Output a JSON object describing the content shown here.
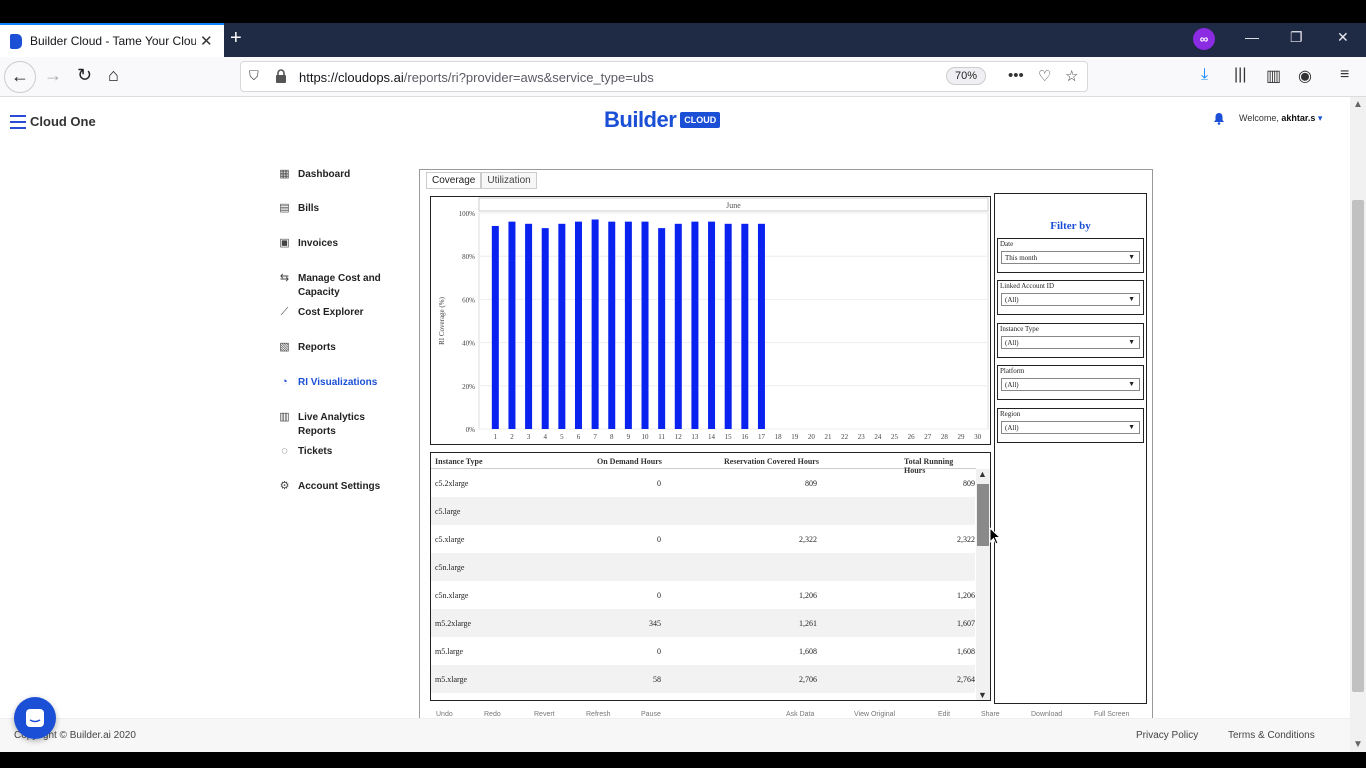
{
  "browser": {
    "tab_title": "Builder Cloud - Tame Your Clou",
    "url_host": "https://cloudops.ai",
    "url_path": "/reports/ri?provider=aws&service_type=ubs",
    "zoom": "70%"
  },
  "header": {
    "brand": "Cloud One",
    "logo_word": "Builder",
    "logo_badge": "CLOUD",
    "welcome_prefix": "Welcome,",
    "username": "akhtar.s",
    "username_caret": "▾"
  },
  "sidebar": {
    "items": [
      {
        "label": "Dashboard",
        "icon": "grid-icon"
      },
      {
        "label": "Bills",
        "icon": "list-icon"
      },
      {
        "label": "Invoices",
        "icon": "invoice-icon"
      },
      {
        "label": "Manage Cost and Capacity",
        "icon": "arrows-icon"
      },
      {
        "label": "Cost Explorer",
        "icon": "trend-icon"
      },
      {
        "label": "Reports",
        "icon": "report-icon"
      },
      {
        "label": "RI Visualizations",
        "icon": "pie-icon",
        "active": true
      },
      {
        "label": "Live Analytics Reports",
        "icon": "bar-chart-icon"
      },
      {
        "label": "Tickets",
        "icon": "chat-bubble-icon"
      },
      {
        "label": "Account Settings",
        "icon": "gear-icon"
      }
    ]
  },
  "report": {
    "tabs": [
      "Coverage",
      "Utilization"
    ],
    "active_tab": "Coverage",
    "filter_title": "Filter by",
    "filters": [
      {
        "label": "Date",
        "value": "This month"
      },
      {
        "label": "Linked Account ID",
        "value": "(All)"
      },
      {
        "label": "Instance Type",
        "value": "(All)"
      },
      {
        "label": "Platform",
        "value": "(All)"
      },
      {
        "label": "Region",
        "value": "(All)"
      }
    ],
    "table": {
      "columns": [
        "Instance Type",
        "On Demand Hours",
        "Reservation Covered Hours",
        "Total Running Hours"
      ],
      "rows": [
        [
          "c5.2xlarge",
          "0",
          "809",
          "809"
        ],
        [
          "c5.large",
          "",
          "",
          ""
        ],
        [
          "c5.xlarge",
          "0",
          "2,322",
          "2,322"
        ],
        [
          "c5n.large",
          "",
          "",
          ""
        ],
        [
          "c5n.xlarge",
          "0",
          "1,206",
          "1,206"
        ],
        [
          "m5.2xlarge",
          "345",
          "1,261",
          "1,607"
        ],
        [
          "m5.large",
          "0",
          "1,608",
          "1,608"
        ],
        [
          "m5.xlarge",
          "58",
          "2,706",
          "2,764"
        ]
      ]
    },
    "toolbar": [
      "Undo",
      "Redo",
      "Revert",
      "Refresh",
      "Pause",
      "Ask Data",
      "View Original",
      "Edit",
      "Share",
      "Download",
      "Full Screen"
    ]
  },
  "chart_data": {
    "type": "bar",
    "title": "June",
    "ylabel": "RI Coverage (%)",
    "xlabel": "",
    "ylim": [
      0,
      100
    ],
    "yticks": [
      "0%",
      "20%",
      "40%",
      "60%",
      "80%",
      "100%"
    ],
    "categories": [
      "1",
      "2",
      "3",
      "4",
      "5",
      "6",
      "7",
      "8",
      "9",
      "10",
      "11",
      "12",
      "13",
      "14",
      "15",
      "16",
      "17",
      "18",
      "19",
      "20",
      "21",
      "22",
      "23",
      "24",
      "25",
      "26",
      "27",
      "28",
      "29",
      "30"
    ],
    "values": [
      94,
      96,
      95,
      93,
      95,
      96,
      97,
      96,
      96,
      96,
      93,
      95,
      96,
      96,
      95,
      95,
      95,
      null,
      null,
      null,
      null,
      null,
      null,
      null,
      null,
      null,
      null,
      null,
      null,
      null
    ],
    "bar_color": "#0a22f0",
    "grid": true
  },
  "footer": {
    "copyright": "Copyright © Builder.ai 2020",
    "privacy": "Privacy Policy",
    "terms": "Terms & Conditions"
  },
  "colors": {
    "accent": "#1a4fd6",
    "bar": "#0a22f0"
  }
}
